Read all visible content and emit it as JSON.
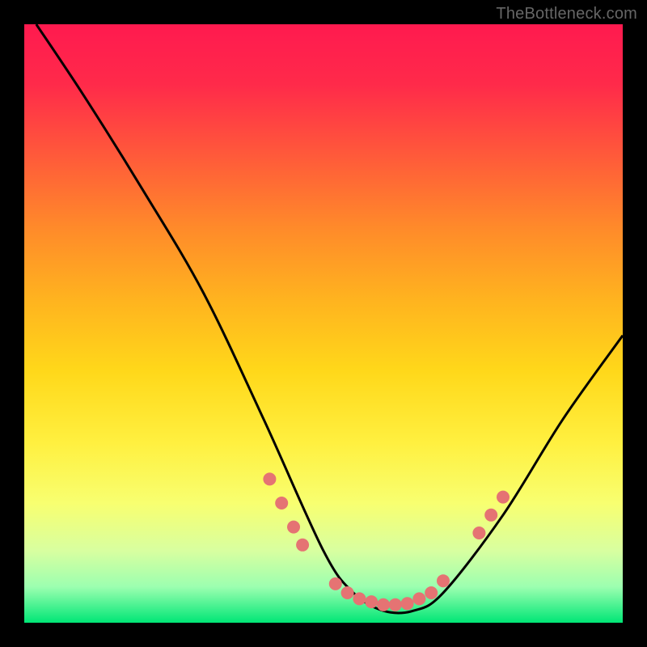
{
  "watermark": "TheBottleneck.com",
  "chart_data": {
    "type": "line",
    "title": "",
    "xlabel": "",
    "ylabel": "",
    "xlim": [
      0,
      100
    ],
    "ylim": [
      0,
      100
    ],
    "grid": false,
    "legend": false,
    "series": [
      {
        "name": "bottleneck-curve",
        "color": "#000000",
        "x": [
          2,
          10,
          20,
          30,
          40,
          50,
          55,
          60,
          65,
          70,
          80,
          90,
          100
        ],
        "y": [
          100,
          88,
          72,
          55,
          34,
          12,
          5,
          2,
          2,
          5,
          18,
          34,
          48
        ]
      }
    ],
    "markers": [
      {
        "x": 41,
        "y": 24,
        "color": "#e57373"
      },
      {
        "x": 43,
        "y": 20,
        "color": "#e57373"
      },
      {
        "x": 45,
        "y": 16,
        "color": "#e57373"
      },
      {
        "x": 46.5,
        "y": 13,
        "color": "#e57373"
      },
      {
        "x": 52,
        "y": 6.5,
        "color": "#e57373"
      },
      {
        "x": 54,
        "y": 5,
        "color": "#e57373"
      },
      {
        "x": 56,
        "y": 4,
        "color": "#e57373"
      },
      {
        "x": 58,
        "y": 3.5,
        "color": "#e57373"
      },
      {
        "x": 60,
        "y": 3,
        "color": "#e57373"
      },
      {
        "x": 62,
        "y": 3,
        "color": "#e57373"
      },
      {
        "x": 64,
        "y": 3.2,
        "color": "#e57373"
      },
      {
        "x": 66,
        "y": 4,
        "color": "#e57373"
      },
      {
        "x": 68,
        "y": 5,
        "color": "#e57373"
      },
      {
        "x": 70,
        "y": 7,
        "color": "#e57373"
      },
      {
        "x": 76,
        "y": 15,
        "color": "#e57373"
      },
      {
        "x": 78,
        "y": 18,
        "color": "#e57373"
      },
      {
        "x": 80,
        "y": 21,
        "color": "#e57373"
      }
    ]
  }
}
